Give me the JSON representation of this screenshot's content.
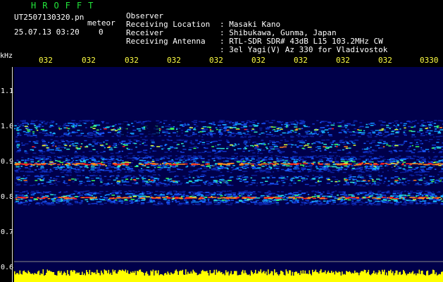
{
  "header": {
    "brand": "HROFFT",
    "filename": "UT2507130320.pn",
    "tag": "meteor",
    "datetime": "25.07.13 03:20",
    "count": "0"
  },
  "info": [
    {
      "label": "Observer",
      "value": ": Masaki Kano"
    },
    {
      "label": "Receiving Location",
      "value": ": Shibukawa, Gunma, Japan"
    },
    {
      "label": "Receiver",
      "value": ": RTL-SDR SDR# 43dB L15 103.2MHz CW"
    },
    {
      "label": "Receiving Antenna",
      "value": ": 3el Yagi(V) Az 330 for Vladivostok"
    }
  ],
  "axis": {
    "y_unit": "kHz",
    "y_labels": [
      "1.1",
      "1.0",
      "0.9",
      "0.8",
      "0.7",
      "0.6"
    ],
    "x_labels": [
      "032",
      "032",
      "032",
      "032",
      "032",
      "032",
      "032",
      "032",
      "032",
      "0330"
    ]
  },
  "colors": {
    "background": "#000000",
    "plot_bg": "#00004a",
    "brand": "#22e63a",
    "time_labels": "#ffff44",
    "signal_bar": "#ffff00"
  }
}
